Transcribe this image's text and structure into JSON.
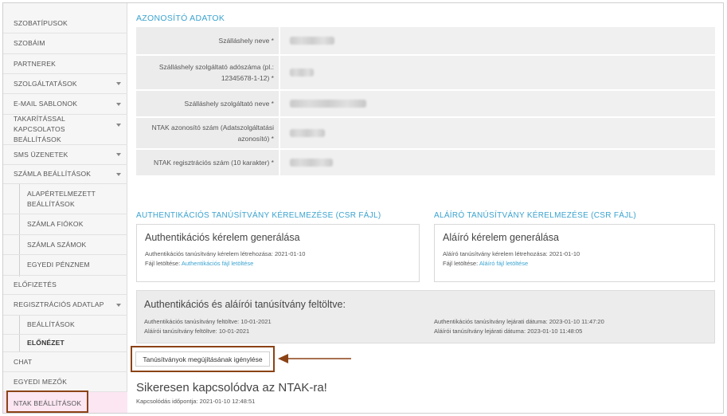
{
  "sidebar": {
    "items": [
      {
        "label": "Szobatípusok"
      },
      {
        "label": "Szobáim"
      },
      {
        "label": "Partnerek"
      },
      {
        "label": "Szolgáltatások"
      },
      {
        "label": "E-mail sablonok"
      },
      {
        "label": "Takarítással kapcsolatos beállítások"
      },
      {
        "label": "SMS üzenetek"
      },
      {
        "label": "Számla beállítások"
      },
      {
        "label": "Alapértelmezett beállítások"
      },
      {
        "label": "Számla fiókok"
      },
      {
        "label": "Számla számok"
      },
      {
        "label": "Egyedi pénznem"
      },
      {
        "label": "Előfizetés"
      },
      {
        "label": "Regisztrációs adatlap"
      },
      {
        "label": "Beállítások"
      },
      {
        "label": "Előnézet"
      },
      {
        "label": "Chat"
      },
      {
        "label": "Egyedi mezők"
      },
      {
        "label": "NTAK beállítások"
      }
    ]
  },
  "identity": {
    "title": "Azonosító adatok",
    "fields": [
      {
        "label": "Szálláshely neve *"
      },
      {
        "label": "Szálláshely szolgáltató adószáma (pl.: 12345678-1-12) *"
      },
      {
        "label": "Szálláshely szolgáltató neve *"
      },
      {
        "label": "NTAK azonosító szám (Adatszolgáltatási azonosító) *"
      },
      {
        "label": "NTAK regisztrációs szám (10 karakter) *"
      }
    ]
  },
  "auth_csr": {
    "title": "Authentikációs tanúsítvány kérelmezése (CSR fájl)",
    "card_title": "Authentikációs kérelem generálása",
    "created_label": "Authentikációs tanúsítvány kérelem létrehozása:",
    "created_value": "2021-01-10",
    "download_label": "Fájl letöltése:",
    "download_link": "Authentikációs fájl letöltése"
  },
  "sign_csr": {
    "title": "Aláíró tanúsítvány kérelmezése (CSR fájl)",
    "card_title": "Aláíró kérelem generálása",
    "created_label": "Aláíró tanúsítvány kérelem létrehozása:",
    "created_value": "2021-01-10",
    "download_label": "Fájl letöltése:",
    "download_link": "Aláíró fájl letöltése"
  },
  "uploaded": {
    "title": "Authentikációs és aláírói tanúsítvány feltöltve:",
    "auth_uploaded_label": "Authentikációs tanúsítvány feltöltve:",
    "auth_uploaded_value": "10-01-2021",
    "sign_uploaded_label": "Aláírói tanúsítvány feltöltve:",
    "sign_uploaded_value": "10-01-2021",
    "auth_expiry_label": "Authentikációs tanúsítvány lejárati dátuma:",
    "auth_expiry_value": "2023-01-10 11:47:20",
    "sign_expiry_label": "Aláírói tanúsítvány lejárati dátuma:",
    "sign_expiry_value": "2023-01-10 11:48:05"
  },
  "renew_button": "Tanúsítványok megújításának igénylése",
  "connection": {
    "title": "Sikeresen kapcsolódva az NTAK-ra!",
    "time_label": "Kapcsolódás időpontja:",
    "time_value": "2021-01-10 12:48:51"
  },
  "colors": {
    "accent": "#3ba3cf",
    "highlight_box": "#8b4316",
    "active_bg": "#fbe6f2"
  }
}
